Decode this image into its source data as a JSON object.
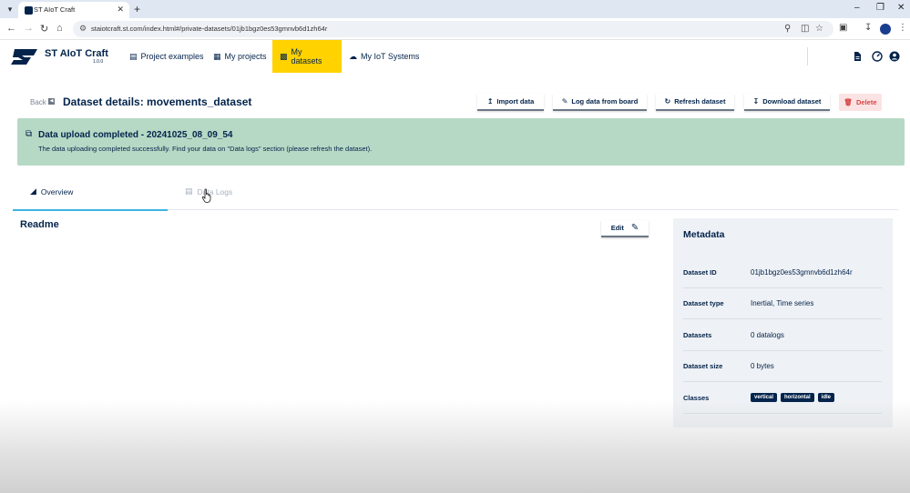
{
  "browser": {
    "tab_title": "ST AIoT Craft",
    "url": "staiotcraft.st.com/index.html#/private-datasets/01jb1bgz0es53gmnvb6d1zh64r"
  },
  "header": {
    "brand": "ST AIoT Craft",
    "version": "1.0.0",
    "nav": [
      {
        "label": "Project examples",
        "icon": "book-icon"
      },
      {
        "label": "My projects",
        "icon": "folder-icon"
      },
      {
        "label": "My datasets",
        "icon": "chart-icon",
        "active": true
      },
      {
        "label": "My IoT Systems",
        "icon": "cloud-icon"
      }
    ],
    "accent_color": "#ffd200"
  },
  "page": {
    "back_label": "Back",
    "title": "Dataset details: movements_dataset",
    "actions": {
      "import": "Import data",
      "log": "Log data from board",
      "refresh": "Refresh dataset",
      "download": "Download dataset",
      "delete": "Delete"
    }
  },
  "alert": {
    "title": "Data upload completed - 20241025_08_09_54",
    "text": "The data uploading completed successfully. Find your data on \"Data logs\" section (please refresh the dataset).",
    "color": "#b6d9c5"
  },
  "tabs": {
    "overview": "Overview",
    "data_logs": "Data Logs"
  },
  "readme": {
    "title": "Readme",
    "edit_label": "Edit"
  },
  "metadata": {
    "title": "Metadata",
    "rows": [
      {
        "label": "Dataset ID",
        "value": "01jb1bgz0es53gmnvb6d1zh64r"
      },
      {
        "label": "Dataset type",
        "value": "Inertial, Time series"
      },
      {
        "label": "Datasets",
        "value": "0 datalogs"
      },
      {
        "label": "Dataset size",
        "value": "0 bytes"
      },
      {
        "label": "Classes",
        "chips": [
          "vertical",
          "horizontal",
          "idle"
        ]
      }
    ]
  }
}
